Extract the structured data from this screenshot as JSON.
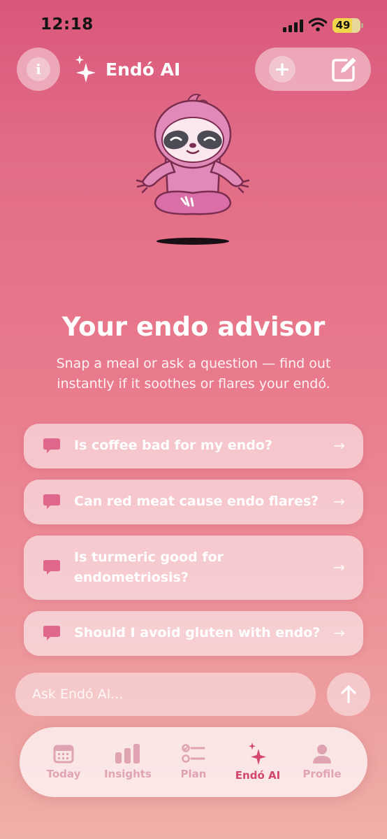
{
  "status_bar": {
    "time": "12:18",
    "battery": "49"
  },
  "header": {
    "title": "Endó AI"
  },
  "hero": {
    "headline": "Your endo advisor",
    "subtitle": "Snap a meal or ask a question — find out instantly if it soothes or flares your endó."
  },
  "suggestions": [
    {
      "text": "Is coffee bad for my endo?",
      "arrow": "→"
    },
    {
      "text": "Can red meat cause endo flares?",
      "arrow": "→"
    },
    {
      "text": "Is turmeric good for endometriosis?",
      "arrow": "→"
    },
    {
      "text": "Should I avoid gluten with endo?",
      "arrow": "→"
    }
  ],
  "composer": {
    "placeholder": "Ask Endó AI..."
  },
  "tabs": [
    {
      "label": "Today",
      "icon": "calendar-icon"
    },
    {
      "label": "Insights",
      "icon": "bar-chart-icon"
    },
    {
      "label": "Plan",
      "icon": "checklist-icon"
    },
    {
      "label": "Endó AI",
      "icon": "sparkles-icon",
      "active": true
    },
    {
      "label": "Profile",
      "icon": "person-icon"
    }
  ],
  "colors": {
    "accent": "#d2456d",
    "inactive_tab": "#e0a3b2",
    "background_top": "#d9577a",
    "background_bottom": "#efb0a8"
  }
}
